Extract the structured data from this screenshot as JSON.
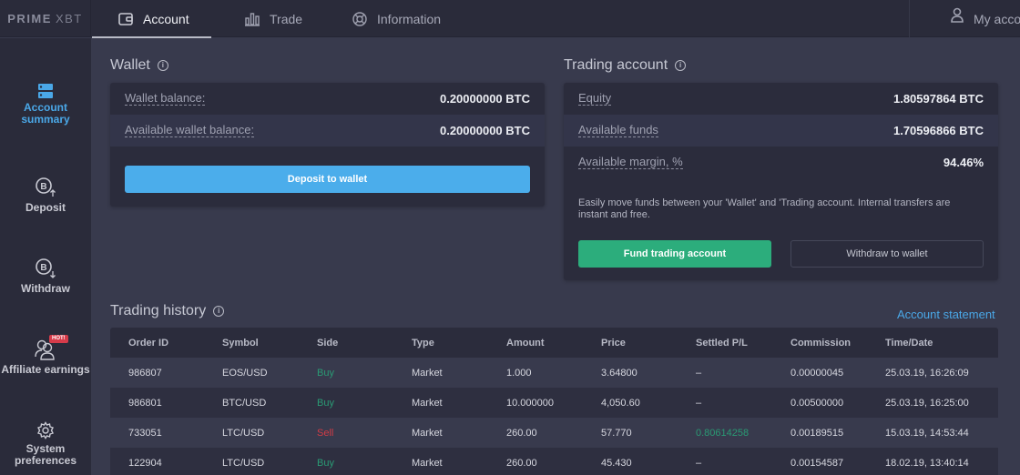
{
  "app": {
    "logo_brand": "PRIME",
    "logo_suffix": "XBT"
  },
  "topnav": {
    "tabs": [
      {
        "label": "Account",
        "icon": "wallet-icon",
        "active": true
      },
      {
        "label": "Trade",
        "icon": "bar-chart-icon",
        "active": false
      },
      {
        "label": "Information",
        "icon": "lifebuoy-icon",
        "active": false
      }
    ],
    "my_account": {
      "label": "My account",
      "icon": "user-icon"
    }
  },
  "sidebar": {
    "items": [
      {
        "label_line1": "Account",
        "label_line2": "summary",
        "icon": "account-summary-icon",
        "active": true
      },
      {
        "label_line1": "Deposit",
        "label_line2": "",
        "icon": "bitcoin-deposit-icon",
        "active": false
      },
      {
        "label_line1": "Withdraw",
        "label_line2": "",
        "icon": "bitcoin-withdraw-icon",
        "active": false
      },
      {
        "label_line1": "Affiliate earnings",
        "label_line2": "",
        "icon": "affiliate-users-icon",
        "badge": "HOT!",
        "active": false
      },
      {
        "label_line1": "System",
        "label_line2": "preferences",
        "icon": "gear-icon",
        "active": false
      }
    ]
  },
  "wallet": {
    "title": "Wallet",
    "rows": [
      {
        "label": "Wallet balance:",
        "value": "0.20000000 BTC"
      },
      {
        "label": "Available wallet balance:",
        "value": "0.20000000 BTC"
      }
    ],
    "deposit_button": "Deposit to wallet"
  },
  "trading_account": {
    "title": "Trading account",
    "rows": [
      {
        "label": "Equity",
        "value": "1.80597864 BTC"
      },
      {
        "label": "Available funds",
        "value": "1.70596866 BTC"
      },
      {
        "label": "Available margin, %",
        "value": "94.46%"
      }
    ],
    "note": "Easily move funds between your 'Wallet' and 'Trading account. Internal transfers are instant and free.",
    "fund_button": "Fund trading account",
    "withdraw_button": "Withdraw to wallet"
  },
  "trading_history": {
    "title": "Trading history",
    "statement_link": "Account statement",
    "columns": [
      "Order ID",
      "Symbol",
      "Side",
      "Type",
      "Amount",
      "Price",
      "Settled P/L",
      "Commission",
      "Time/Date"
    ],
    "rows": [
      {
        "order_id": "986807",
        "symbol": "EOS/USD",
        "side": "Buy",
        "type": "Market",
        "amount": "1.000",
        "price": "3.64800",
        "settled_pl": "–",
        "commission": "0.00000045",
        "time": "25.03.19, 16:26:09"
      },
      {
        "order_id": "986801",
        "symbol": "BTC/USD",
        "side": "Buy",
        "type": "Market",
        "amount": "10.000000",
        "price": "4,050.60",
        "settled_pl": "–",
        "commission": "0.00500000",
        "time": "25.03.19, 16:25:00"
      },
      {
        "order_id": "733051",
        "symbol": "LTC/USD",
        "side": "Sell",
        "type": "Market",
        "amount": "260.00",
        "price": "57.770",
        "settled_pl": "0.80614258",
        "commission": "0.00189515",
        "time": "15.03.19, 14:53:44"
      },
      {
        "order_id": "122904",
        "symbol": "LTC/USD",
        "side": "Buy",
        "type": "Market",
        "amount": "260.00",
        "price": "45.430",
        "settled_pl": "–",
        "commission": "0.00154587",
        "time": "18.02.19, 13:40:14"
      }
    ]
  },
  "colors": {
    "accent_blue": "#4badeb",
    "buy_green": "#2a9a74",
    "sell_red": "#d13c46",
    "fund_green": "#2cad7c",
    "hot_badge": "#d63b4a"
  }
}
